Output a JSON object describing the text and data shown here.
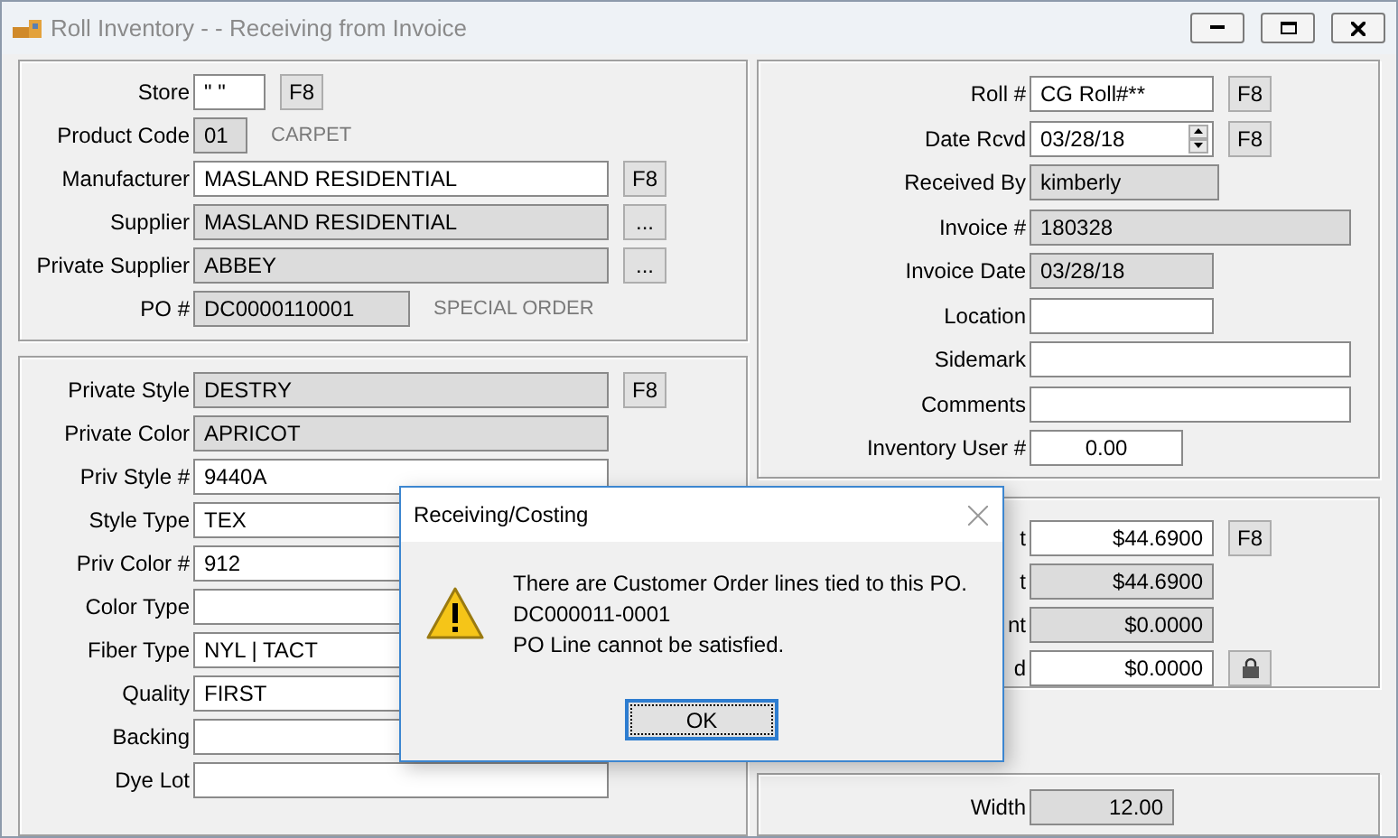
{
  "window": {
    "title": "Roll Inventory - - Receiving from Invoice"
  },
  "product": [
    {
      "label": "Store",
      "value": "\" \"",
      "readonly": false,
      "button": {
        "kind": "text",
        "label": "F8"
      }
    },
    {
      "label": "Product Code",
      "value": "01",
      "readonly": true,
      "note": "CARPET"
    },
    {
      "label": "Manufacturer",
      "value": "MASLAND RESIDENTIAL",
      "readonly": false,
      "button": {
        "kind": "text",
        "label": "F8"
      }
    },
    {
      "label": "Supplier",
      "value": "MASLAND RESIDENTIAL",
      "readonly": true,
      "button": {
        "kind": "text",
        "label": "..."
      }
    },
    {
      "label": "Private Supplier",
      "value": "ABBEY",
      "readonly": true,
      "button": {
        "kind": "text",
        "label": "..."
      }
    },
    {
      "label": "PO #",
      "value": "DC0000110001",
      "readonly": true,
      "note": "SPECIAL ORDER"
    }
  ],
  "style": [
    {
      "label": "Private Style",
      "value": "DESTRY",
      "readonly": true,
      "button": {
        "kind": "text",
        "label": "F8"
      }
    },
    {
      "label": "Private Color",
      "value": "APRICOT",
      "readonly": true
    },
    {
      "label": "Priv Style #",
      "value": "9440A",
      "readonly": false
    },
    {
      "label": "Style Type",
      "value": "TEX",
      "readonly": false
    },
    {
      "label": "Priv Color #",
      "value": "912",
      "readonly": false
    },
    {
      "label": "Color Type",
      "readonly": false
    },
    {
      "label": "Fiber Type",
      "value": "NYL | TACT",
      "readonly": false
    },
    {
      "label": "Quality",
      "value": "FIRST",
      "readonly": false
    },
    {
      "label": "Backing",
      "readonly": false
    },
    {
      "label": "Dye Lot",
      "readonly": false
    }
  ],
  "roll": [
    {
      "label": "Roll #",
      "value": "CG Roll#**",
      "readonly": false,
      "button": {
        "kind": "text",
        "label": "F8"
      }
    },
    {
      "label": "Date Rcvd",
      "value": "03/28/18",
      "readonly": false,
      "spinner": true,
      "button": {
        "kind": "text",
        "label": "F8"
      }
    },
    {
      "label": "Received By",
      "value": "kimberly",
      "readonly": true
    },
    {
      "label": "Invoice #",
      "value": "180328",
      "readonly": true
    },
    {
      "label": "Invoice Date",
      "value": "03/28/18",
      "readonly": true
    },
    {
      "label": "Location",
      "readonly": false
    },
    {
      "label": "Sidemark",
      "readonly": false
    },
    {
      "label": "Comments",
      "readonly": false
    },
    {
      "label": "Inventory User #",
      "value": "0.00",
      "readonly": false
    }
  ],
  "costing": [
    {
      "label": "t",
      "value": "$44.6900",
      "readonly": false,
      "button": {
        "kind": "text",
        "label": "F8"
      }
    },
    {
      "label": "t",
      "value": "$44.6900",
      "readonly": true
    },
    {
      "label": "nt",
      "value": "$0.0000",
      "readonly": true
    },
    {
      "label": "d",
      "value": "$0.0000",
      "readonly": false,
      "button": {
        "kind": "lock"
      }
    }
  ],
  "size": [
    {
      "label": "Width",
      "value": "12.00",
      "readonly": true
    }
  ],
  "dialog": {
    "title": "Receiving/Costing",
    "lines": [
      "There are Customer Order lines tied to this PO.",
      "DC000011-0001",
      "PO Line cannot be satisfied."
    ],
    "button": "OK"
  }
}
